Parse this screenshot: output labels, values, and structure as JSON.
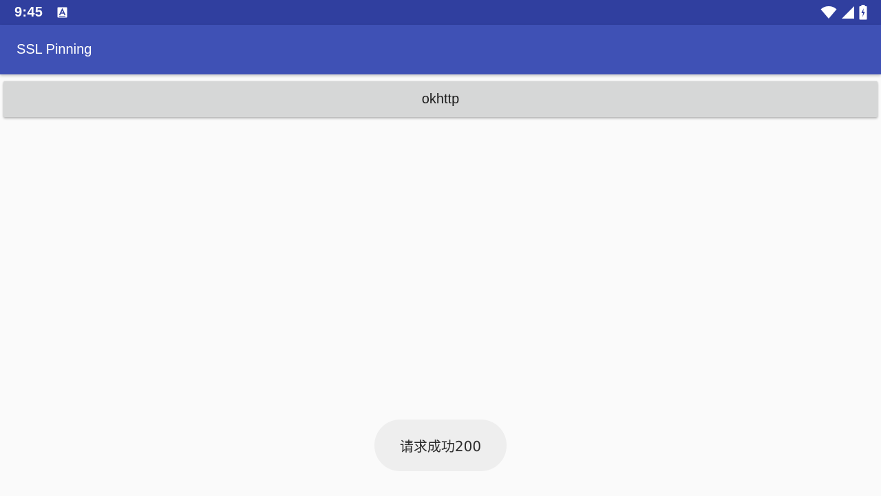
{
  "status_bar": {
    "time": "9:45",
    "notification_icon": "text-a-icon",
    "icons": [
      "wifi-icon",
      "cell-signal-icon",
      "battery-charging-icon"
    ],
    "background_color": "#303f9f"
  },
  "app_bar": {
    "title": "SSL Pinning",
    "background_color": "#3f51b5"
  },
  "main": {
    "button_label": "okhttp"
  },
  "toast": {
    "message": "请求成功200"
  }
}
